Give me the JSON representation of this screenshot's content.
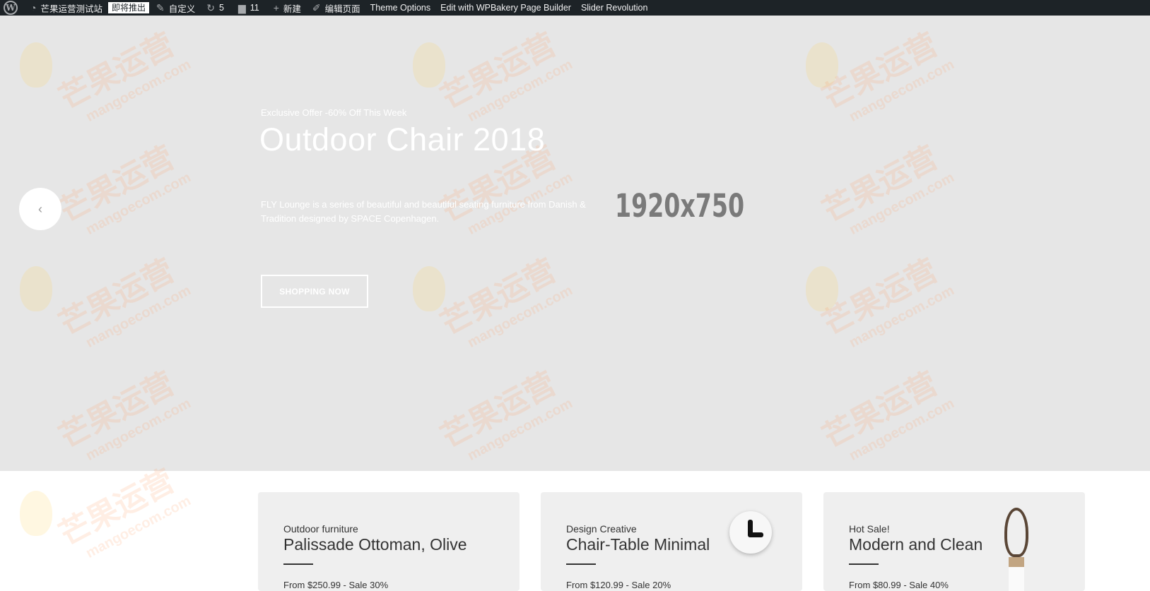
{
  "admin_bar": {
    "site_name": "芒果运营测试站",
    "launch_badge": "即将推出",
    "customize": "自定义",
    "updates_count": "5",
    "comments_count": "11",
    "new_label": "新建",
    "edit_page": "编辑页面",
    "theme_options": "Theme Options",
    "wpbakery": "Edit with WPBakery Page Builder",
    "slider_revolution": "Slider Revolution"
  },
  "hero": {
    "subtitle": "Exclusive Offer -60% Off This Week",
    "title": "Outdoor Chair 2018",
    "description": "FLY Lounge is a series of beautiful and beautiful seating furniture from Danish & Tradition designed by SPACE Copenhagen.",
    "placeholder_dimensions": "1920x750",
    "button_label": "SHOPPING NOW",
    "prev_arrow": "‹"
  },
  "watermark": {
    "text": "芒果运营",
    "url": "mangoecom.com"
  },
  "products": [
    {
      "category": "Outdoor furniture",
      "name": "Palissade Ottoman, Olive",
      "price": "From $250.99 - Sale 30%"
    },
    {
      "category": "Design Creative",
      "name": "Chair-Table Minimal",
      "price": "From $120.99 - Sale 20%"
    },
    {
      "category": "Hot Sale!",
      "name": "Modern and Clean",
      "price": "From $80.99 - Sale 40%"
    }
  ],
  "icons": {
    "wp_logo": "wordpress-icon",
    "dashboard": "dashboard-icon",
    "brush": "brush-icon",
    "updates": "refresh-icon",
    "comments": "comment-icon",
    "new": "plus-icon",
    "edit": "pencil-icon"
  }
}
